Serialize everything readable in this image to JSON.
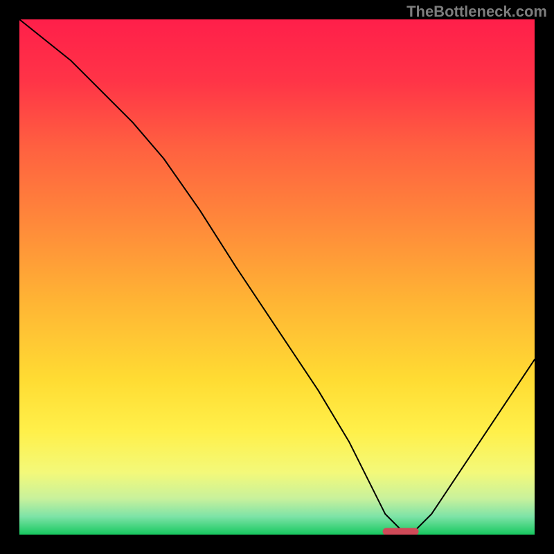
{
  "watermark": "TheBottleneck.com",
  "chart_data": {
    "type": "line",
    "title": "",
    "xlabel": "",
    "ylabel": "",
    "xlim": [
      0,
      100
    ],
    "ylim": [
      0,
      100
    ],
    "grid": false,
    "legend": false,
    "marker": {
      "x": 74,
      "y": 0.6,
      "color": "#cf4a58",
      "width": 7,
      "height": 1.4,
      "radius": 0.7
    },
    "series": [
      {
        "name": "curve",
        "color": "#000000",
        "x": [
          0,
          10,
          22,
          28,
          35,
          42,
          50,
          58,
          64,
          68,
          71,
          74,
          77,
          80,
          84,
          88,
          92,
          96,
          100
        ],
        "values": [
          100,
          92,
          80,
          73,
          63,
          52,
          40,
          28,
          18,
          10,
          4,
          1,
          1,
          4,
          10,
          16,
          22,
          28,
          34
        ]
      }
    ],
    "background_gradient": [
      {
        "pos": 0.0,
        "color": "#ff1f4a"
      },
      {
        "pos": 0.12,
        "color": "#ff3447"
      },
      {
        "pos": 0.25,
        "color": "#ff6140"
      },
      {
        "pos": 0.4,
        "color": "#ff8a3a"
      },
      {
        "pos": 0.55,
        "color": "#ffb534"
      },
      {
        "pos": 0.7,
        "color": "#ffdc33"
      },
      {
        "pos": 0.8,
        "color": "#fff04a"
      },
      {
        "pos": 0.88,
        "color": "#f3f97a"
      },
      {
        "pos": 0.93,
        "color": "#c8f19c"
      },
      {
        "pos": 0.965,
        "color": "#7de3a7"
      },
      {
        "pos": 1.0,
        "color": "#17c85f"
      }
    ]
  }
}
